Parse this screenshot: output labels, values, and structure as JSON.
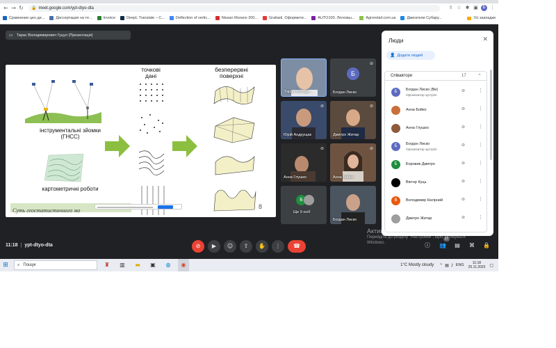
{
  "browser": {
    "url": "meet.google.com/ypt-dtyo-dta",
    "profile_initial": "Б",
    "bookmarks": [
      "Сравнение цен де...",
      "Диссертация на те...",
      "Invoice",
      "DeepL Translate – С...",
      "Deflection of vertic...",
      "Nissan Murano 200...",
      "Grafasti. Оформити...",
      "AUTO100. Легковы...",
      "Agroretail.com.ua",
      "Двигатели Субару..."
    ],
    "bookmark_folder": "Усі закладки"
  },
  "meet": {
    "presentation_title": "Тарас Володимирович Гуцул (Презентація)",
    "clock": "11:18",
    "separator": "|",
    "meeting_code": "ypt-dtyo-dta",
    "chat_badge": "17"
  },
  "slide": {
    "col1_head": "точкові\nдані",
    "col2_head": "безперервні\nповерхні",
    "label_gnss": "інструментальні зйомки\n(ГНСС)",
    "label_carto": "картометричні роботи",
    "banner": "Суть геостатистичного мо",
    "page_number": "8"
  },
  "tiles": [
    {
      "name": "Тарас Володи..."
    },
    {
      "name": "Богдан Лиско",
      "initial": "Б"
    },
    {
      "name": "Юрій Андрущак"
    },
    {
      "name": "Дмитро Житар"
    },
    {
      "name": "Анна Глушко"
    },
    {
      "name": "Анна Бойко"
    },
    {
      "name": "Ще 9 осіб",
      "initial": "Б"
    },
    {
      "name": "Богдан Лиско"
    }
  ],
  "people_panel": {
    "title": "Люди",
    "add_people": "Додати людей",
    "section_label": "Співавтори",
    "section_count": "17",
    "participants": [
      {
        "name": "Богдан Лиско (Ви)",
        "role": "Організатор зустрічі",
        "initial": "Б",
        "color": "#5c6bc0"
      },
      {
        "name": "Анна Бойко",
        "role": "",
        "initial": "",
        "color": "#c96f3b"
      },
      {
        "name": "Анна Глушко",
        "role": "",
        "initial": "",
        "color": "#8d5a3b"
      },
      {
        "name": "Богдан Лиско",
        "role": "Організатор зустрічі",
        "initial": "Б",
        "color": "#5c6bc0"
      },
      {
        "name": "Боровик Дмитро",
        "role": "",
        "initial": "Б",
        "color": "#1e8e3e"
      },
      {
        "name": "Віктор Куць",
        "role": "",
        "initial": "",
        "color": "#000000"
      },
      {
        "name": "Володимир Нагірний",
        "role": "",
        "initial": "В",
        "color": "#e8590c"
      },
      {
        "name": "Дмитро Житар",
        "role": "",
        "initial": "",
        "color": "#9e9e9e"
      }
    ]
  },
  "watermark": {
    "line1": "Активация Windows",
    "line2": "Перейдіть до розділу \"Настройки\", щоб активувати",
    "line3": "Windows."
  },
  "taskbar": {
    "search": "Пошук",
    "weather": "1°C  Mostly cloudy",
    "lang": "ENG",
    "time": "11:18",
    "date": "25.11.2023"
  },
  "colors": {
    "meet_bg": "#202124",
    "leave_red": "#ea4335",
    "accent_blue": "#1a73e8",
    "slide_arrow_green": "#8cbf3f"
  }
}
